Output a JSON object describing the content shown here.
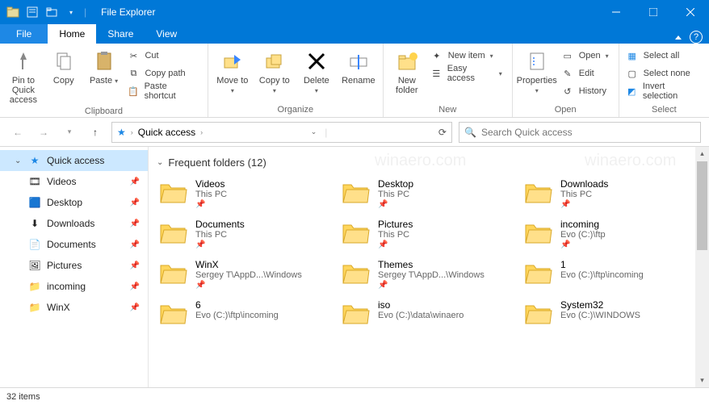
{
  "titlebar": {
    "title": "File Explorer"
  },
  "tabs": {
    "file": "File",
    "home": "Home",
    "share": "Share",
    "view": "View"
  },
  "ribbon": {
    "clipboard": {
      "label": "Clipboard",
      "pinQA": "Pin to Quick access",
      "copy": "Copy",
      "paste": "Paste",
      "cut": "Cut",
      "copyPath": "Copy path",
      "pasteShortcut": "Paste shortcut"
    },
    "organize": {
      "label": "Organize",
      "moveTo": "Move to",
      "copyTo": "Copy to",
      "delete": "Delete",
      "rename": "Rename"
    },
    "new": {
      "label": "New",
      "newFolder": "New folder",
      "newItem": "New item",
      "easyAccess": "Easy access"
    },
    "open": {
      "label": "Open",
      "properties": "Properties",
      "open": "Open",
      "edit": "Edit",
      "history": "History"
    },
    "select": {
      "label": "Select",
      "selectAll": "Select all",
      "selectNone": "Select none",
      "invert": "Invert selection"
    }
  },
  "crumb": {
    "root": "Quick access"
  },
  "search": {
    "placeholder": "Search Quick access"
  },
  "nav": {
    "quickAccess": "Quick access",
    "items": [
      {
        "label": "Videos"
      },
      {
        "label": "Desktop"
      },
      {
        "label": "Downloads"
      },
      {
        "label": "Documents"
      },
      {
        "label": "Pictures"
      },
      {
        "label": "incoming"
      },
      {
        "label": "WinX"
      }
    ]
  },
  "heading": "Frequent folders (12)",
  "folders": [
    {
      "name": "Videos",
      "loc": "This PC",
      "pin": true
    },
    {
      "name": "Desktop",
      "loc": "This PC",
      "pin": true
    },
    {
      "name": "Downloads",
      "loc": "This PC",
      "pin": true
    },
    {
      "name": "Documents",
      "loc": "This PC",
      "pin": true
    },
    {
      "name": "Pictures",
      "loc": "This PC",
      "pin": true
    },
    {
      "name": "incoming",
      "loc": "Evo (C:)\\ftp",
      "pin": true
    },
    {
      "name": "WinX",
      "loc": "Sergey T\\AppD...\\Windows",
      "pin": true
    },
    {
      "name": "Themes",
      "loc": "Sergey T\\AppD...\\Windows",
      "pin": true
    },
    {
      "name": "1",
      "loc": "Evo (C:)\\ftp\\incoming",
      "pin": false
    },
    {
      "name": "6",
      "loc": "Evo (C:)\\ftp\\incoming",
      "pin": false
    },
    {
      "name": "iso",
      "loc": "Evo (C:)\\data\\winaero",
      "pin": false
    },
    {
      "name": "System32",
      "loc": "Evo (C:)\\WINDOWS",
      "pin": false
    }
  ],
  "status": "32 items"
}
